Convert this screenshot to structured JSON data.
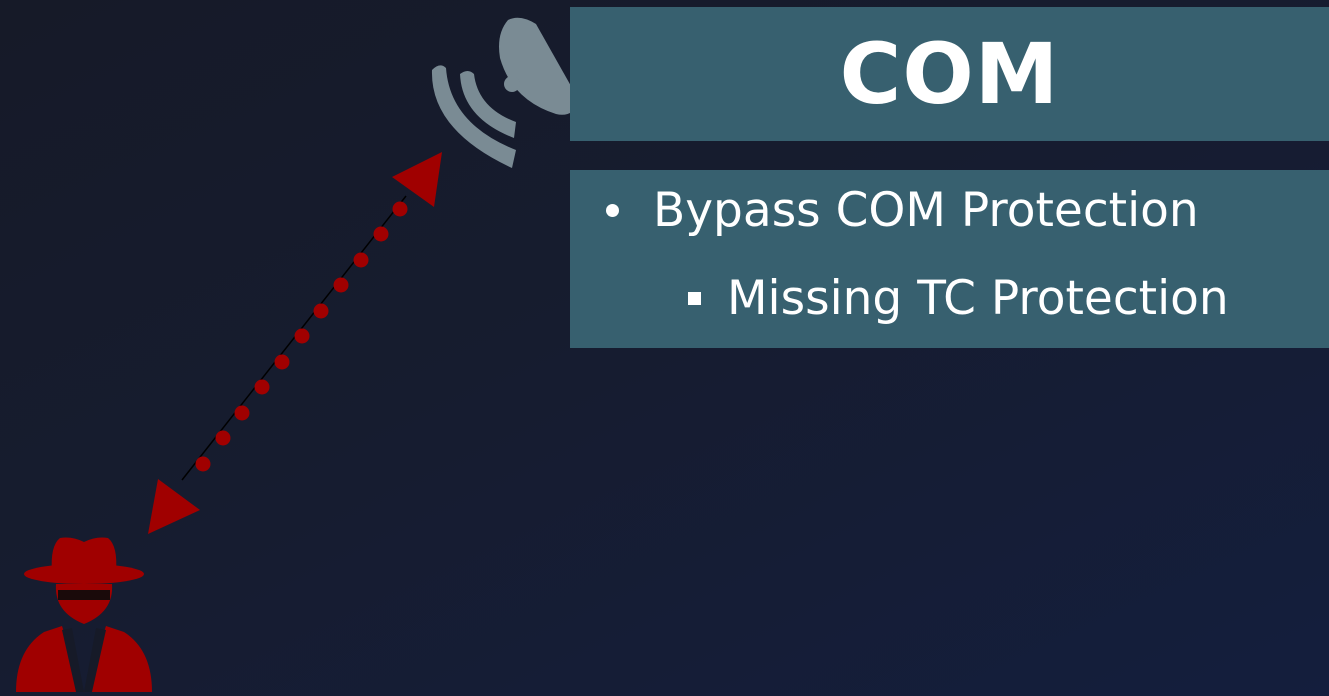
{
  "title": "COM",
  "bullets": [
    {
      "text": "Bypass COM Protection",
      "level": 1
    },
    {
      "text": "Missing TC Protection",
      "level": 2
    }
  ],
  "icons": {
    "satellite": "satellite-dish-icon",
    "attacker": "spy-attacker-icon",
    "link": "bidirectional-dotted-arrow"
  },
  "colors": {
    "background": "#161c2f",
    "panel": "#37606f",
    "text": "#ffffff",
    "attacker": "#a00000",
    "satellite": "#7a8b94"
  }
}
